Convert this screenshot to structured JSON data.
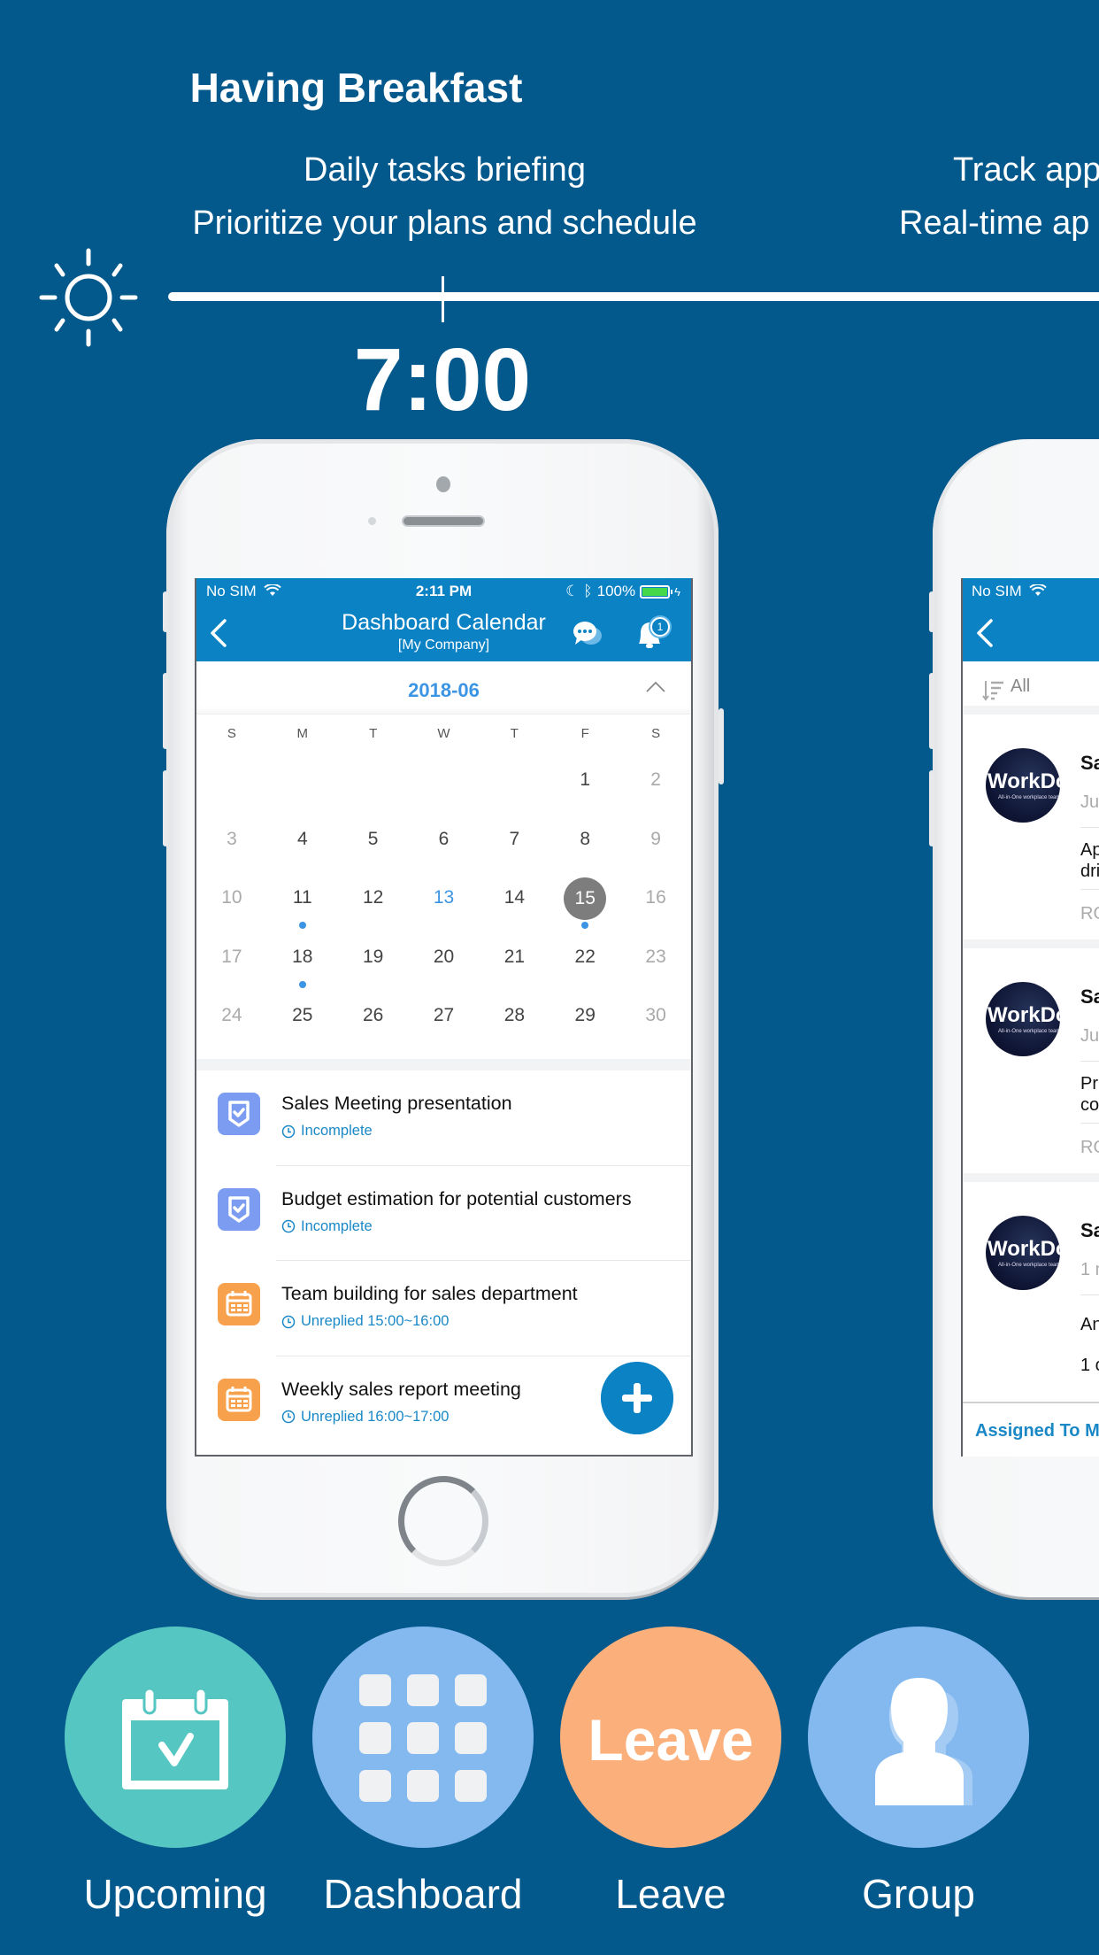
{
  "banner": {
    "headline": "Having Breakfast",
    "subtitle_lines": [
      "Daily tasks briefing",
      "Prioritize your plans and schedule"
    ],
    "next_subtitle_lines_cropped": [
      "Track app",
      "Real-time ap"
    ],
    "time": "7:00",
    "timeline_icon": "sun-icon"
  },
  "phone_main": {
    "status_bar": {
      "carrier": "No SIM",
      "time": "2:11 PM",
      "battery": "100%",
      "battery_color": "#45d84a"
    },
    "nav": {
      "title": "Dashboard Calendar",
      "subtitle": "[My Company]",
      "notification_count": "1",
      "accent_color": "#0a82c4"
    },
    "calendar": {
      "month": "2018-06",
      "weekdays": [
        "S",
        "M",
        "T",
        "W",
        "T",
        "F",
        "S"
      ],
      "weeks": [
        [
          "",
          "",
          "",
          "",
          "",
          "1",
          "2"
        ],
        [
          "3",
          "4",
          "5",
          "6",
          "7",
          "8",
          "9"
        ],
        [
          "10",
          "11",
          "12",
          "13",
          "14",
          "15",
          "16"
        ],
        [
          "17",
          "18",
          "19",
          "20",
          "21",
          "22",
          "23"
        ],
        [
          "24",
          "25",
          "26",
          "27",
          "28",
          "29",
          "30"
        ]
      ],
      "today": "13",
      "selected": "15",
      "days_with_events": [
        "11",
        "15",
        "18"
      ]
    },
    "tasks": [
      {
        "title": "Sales Meeting presentation",
        "status": "Incomplete",
        "icon": "task-shield-icon",
        "color": "purple"
      },
      {
        "title": "Budget estimation for potential customers",
        "status": "Incomplete",
        "icon": "task-shield-icon",
        "color": "purple"
      },
      {
        "title": "Team building for sales department",
        "status": "Unreplied 15:00~16:00",
        "icon": "calendar-icon",
        "color": "orange"
      },
      {
        "title": "Weekly sales report meeting",
        "status": "Unreplied 16:00~17:00",
        "icon": "calendar-icon",
        "color": "orange"
      }
    ],
    "fab_icon": "plus-icon"
  },
  "phone_secondary": {
    "carrier": "No SIM",
    "filter_label": "All",
    "avatar_brand": "WorkDo",
    "avatar_tagline": "All-in-One workplace teamwork/management tool",
    "cards": [
      {
        "title": "Sa",
        "meta": "Ju",
        "body": [
          "Ap",
          "dri"
        ],
        "footer": "RO"
      },
      {
        "title": "Sa",
        "meta": "Ju",
        "body": [
          "Pr",
          "co"
        ],
        "footer": "RO"
      },
      {
        "title": "Sa",
        "meta": "1 m",
        "body": [
          "An",
          "1 c"
        ],
        "footer": ""
      }
    ],
    "footer_tab": "Assigned To M"
  },
  "features": [
    {
      "label": "Upcoming",
      "icon": "calendar-check-icon",
      "color": "#56c6c2"
    },
    {
      "label": "Dashboard",
      "icon": "grid-icon",
      "color": "#84b9ef"
    },
    {
      "label": "Leave",
      "icon_text": "Leave",
      "color": "#fbb07b"
    },
    {
      "label": "Group",
      "icon": "group-icon",
      "color": "#84b9ef"
    }
  ]
}
